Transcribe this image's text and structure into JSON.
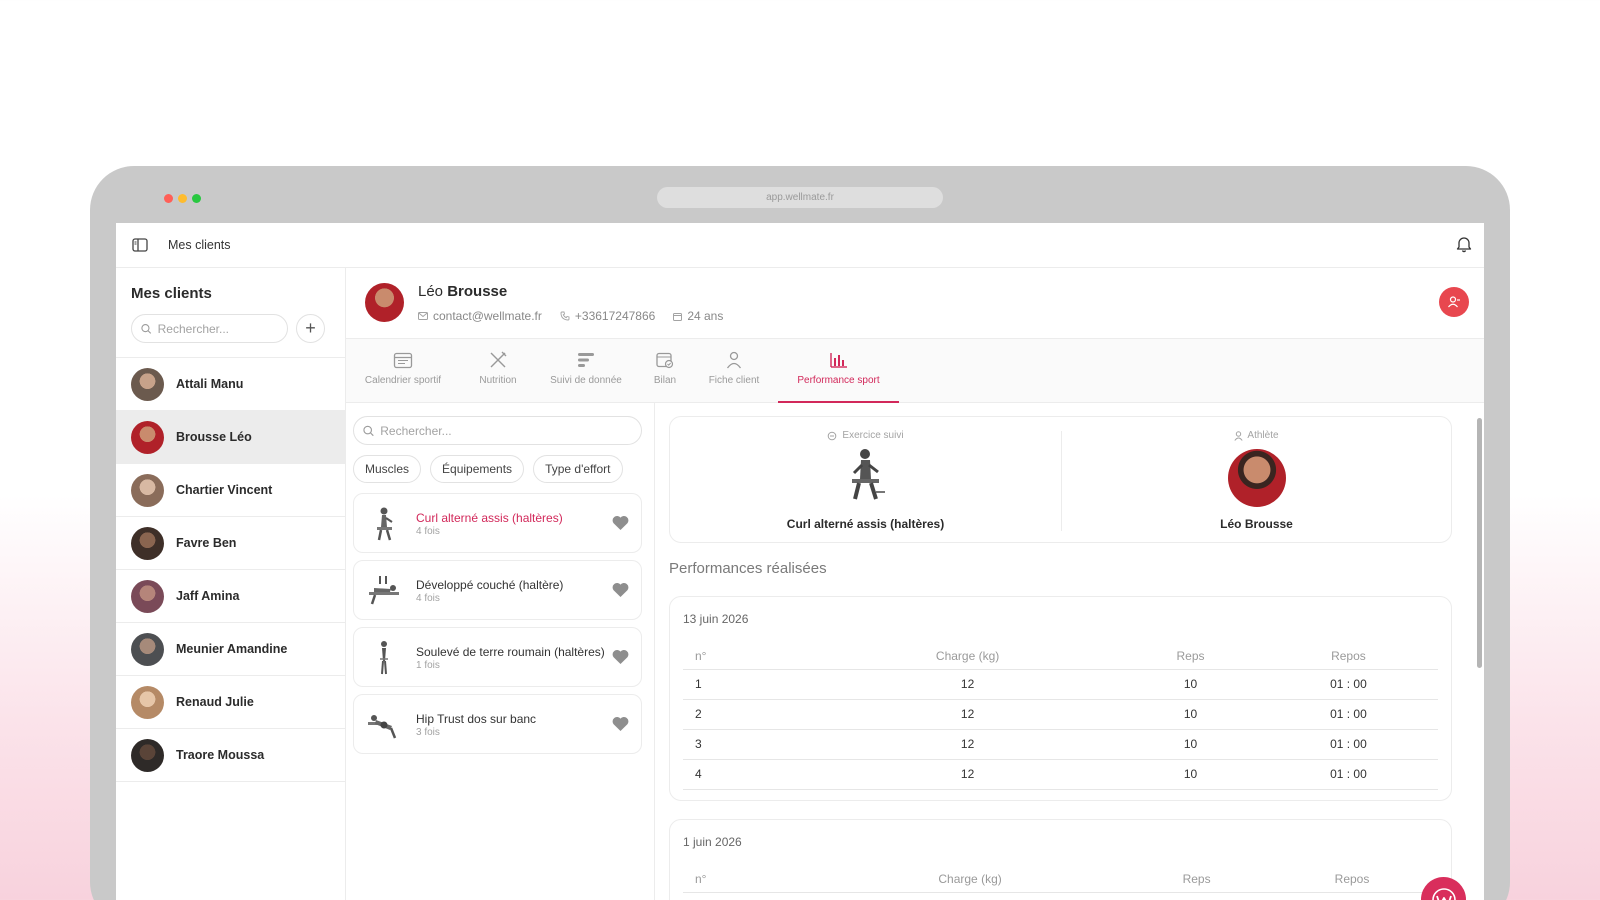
{
  "window": {
    "url": "app.wellmate.fr"
  },
  "topbar": {
    "breadcrumb": "Mes clients"
  },
  "sidebar": {
    "title": "Mes clients",
    "search_placeholder": "Rechercher...",
    "add_label": "+",
    "clients": [
      {
        "name": "Attali Manu",
        "color": "#6b5a4e"
      },
      {
        "name": "Brousse Léo",
        "color": "#b02129",
        "active": true
      },
      {
        "name": "Chartier Vincent",
        "color": "#8a6c5a"
      },
      {
        "name": "Favre Ben",
        "color": "#3e2f28"
      },
      {
        "name": "Jaff Amina",
        "color": "#7a4a58"
      },
      {
        "name": "Meunier Amandine",
        "color": "#4d4f52"
      },
      {
        "name": "Renaud Julie",
        "color": "#b58a66"
      },
      {
        "name": "Traore Moussa",
        "color": "#2e2a28"
      }
    ]
  },
  "client": {
    "first_name": "Léo",
    "last_name": "Brousse",
    "email": "contact@wellmate.fr",
    "phone": "+33617247866",
    "age": "24 ans"
  },
  "tabs": [
    {
      "label": "Calendrier sportif",
      "icon": "calendar-icon"
    },
    {
      "label": "Nutrition",
      "icon": "utensils-icon"
    },
    {
      "label": "Suivi de donnée",
      "icon": "list-icon"
    },
    {
      "label": "Bilan",
      "icon": "checklist-icon"
    },
    {
      "label": "Fiche client",
      "icon": "user-icon"
    },
    {
      "label": "Performance sport",
      "icon": "bar-chart-icon",
      "active": true
    }
  ],
  "exercises": {
    "search_placeholder": "Rechercher...",
    "filters": [
      "Muscles",
      "Équipements",
      "Type d'effort"
    ],
    "items": [
      {
        "title": "Curl alterné assis (haltères)",
        "count": "4 fois",
        "active": true
      },
      {
        "title": "Développé couché (haltère)",
        "count": "4 fois"
      },
      {
        "title": "Soulevé de terre roumain (haltères)",
        "count": "1 fois"
      },
      {
        "title": "Hip Trust dos sur banc",
        "count": "3 fois"
      }
    ]
  },
  "summary": {
    "exercise_label": "Exercice suivi",
    "exercise_name": "Curl alterné assis (haltères)",
    "athlete_label": "Athlète",
    "athlete_name": "Léo Brousse"
  },
  "performances": {
    "title": "Performances réalisées",
    "columns": [
      "n°",
      "Charge (kg)",
      "Reps",
      "Repos"
    ],
    "sessions": [
      {
        "date": "13 juin 2026",
        "rows": [
          [
            "1",
            "12",
            "10",
            "01 : 00"
          ],
          [
            "2",
            "12",
            "10",
            "01 : 00"
          ],
          [
            "3",
            "12",
            "10",
            "01 : 00"
          ],
          [
            "4",
            "12",
            "10",
            "01 : 00"
          ]
        ]
      },
      {
        "date": "1 juin 2026",
        "rows": []
      }
    ]
  },
  "colors": {
    "accent": "#d2285a",
    "red": "#e8474f"
  }
}
